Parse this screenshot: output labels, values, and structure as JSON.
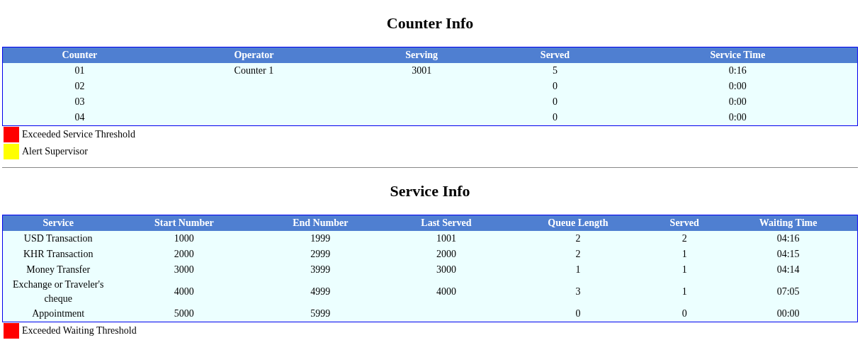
{
  "counter_info": {
    "title": "Counter Info",
    "columns": [
      "Counter",
      "Operator",
      "Serving",
      "Served",
      "Service Time"
    ],
    "rows": [
      [
        "01",
        "Counter 1",
        "3001",
        "5",
        "0:16"
      ],
      [
        "02",
        null,
        null,
        "0",
        "0:00"
      ],
      [
        "03",
        null,
        null,
        "0",
        "0:00"
      ],
      [
        "04",
        null,
        null,
        "0",
        "0:00"
      ]
    ],
    "legend": [
      {
        "label": "Exceeded Service Threshold",
        "color": "#ff0000"
      },
      {
        "label": "Alert Supervisor",
        "color": "#ffff00"
      }
    ]
  },
  "service_info": {
    "title": "Service Info",
    "columns": [
      "Service",
      "Start Number",
      "End Number",
      "Last Served",
      "Queue Length",
      "Served",
      "Waiting Time"
    ],
    "rows": [
      [
        "USD Transaction",
        "1000",
        "1999",
        "1001",
        "2",
        "2",
        "04:16"
      ],
      [
        "KHR Transaction",
        "2000",
        "2999",
        "2000",
        "2",
        "1",
        "04:15"
      ],
      [
        "Money Transfer",
        "3000",
        "3999",
        "3000",
        "1",
        "1",
        "04:14"
      ],
      [
        "Exchange or Traveler's cheque",
        "4000",
        "4999",
        "4000",
        "3",
        "1",
        "07:05"
      ],
      [
        "Appointment",
        "5000",
        "5999",
        null,
        "0",
        "0",
        "00:00"
      ]
    ],
    "legend": [
      {
        "label": "Exceeded Waiting Threshold",
        "color": "#ff0000"
      }
    ]
  }
}
